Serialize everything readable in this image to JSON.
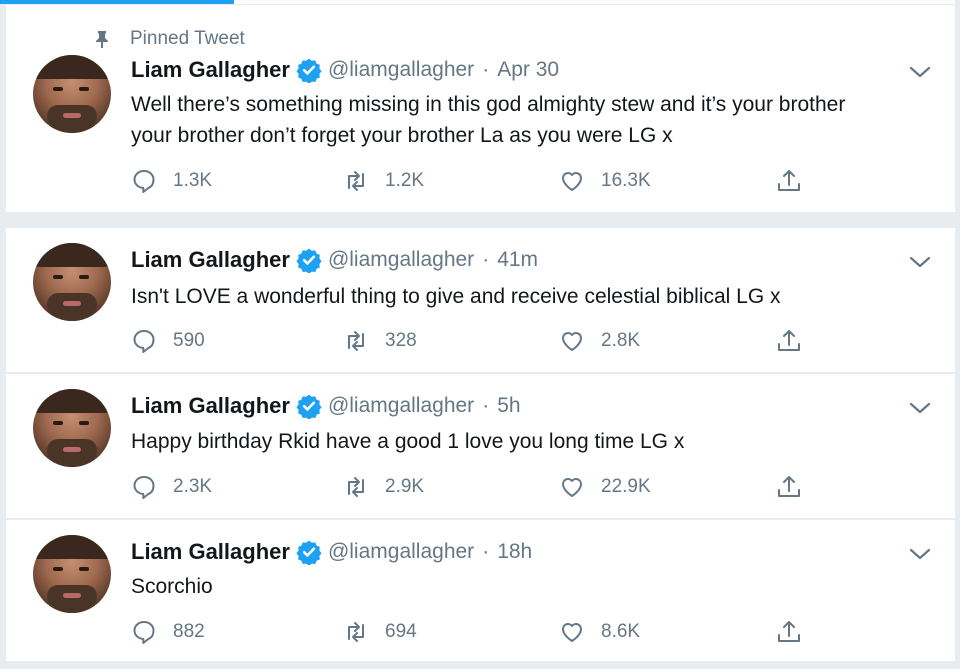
{
  "pinned_label": "Pinned Tweet",
  "colors": {
    "accent": "#1da1f2",
    "muted": "#657786",
    "text": "#14171a",
    "separator": "#e6ecf0"
  },
  "tweets": [
    {
      "name": "Liam Gallagher",
      "handle": "@liamgallagher",
      "dot": "·",
      "time": "Apr 30",
      "text": "Well there’s something missing in this god almighty stew and it’s your brother your brother don’t forget your brother La as you were LG x",
      "replies": "1.3K",
      "retweets": "1.2K",
      "likes": "16.3K"
    },
    {
      "name": "Liam Gallagher",
      "handle": "@liamgallagher",
      "dot": "·",
      "time": "41m",
      "text": "Isn't LOVE a wonderful thing to give and receive celestial biblical LG x",
      "replies": "590",
      "retweets": "328",
      "likes": "2.8K"
    },
    {
      "name": "Liam Gallagher",
      "handle": "@liamgallagher",
      "dot": "·",
      "time": "5h",
      "text": "Happy birthday Rkid have a good 1 love you long time LG x",
      "replies": "2.3K",
      "retweets": "2.9K",
      "likes": "22.9K"
    },
    {
      "name": "Liam Gallagher",
      "handle": "@liamgallagher",
      "dot": "·",
      "time": "18h",
      "text": "Scorchio",
      "replies": "882",
      "retweets": "694",
      "likes": "8.6K"
    }
  ]
}
